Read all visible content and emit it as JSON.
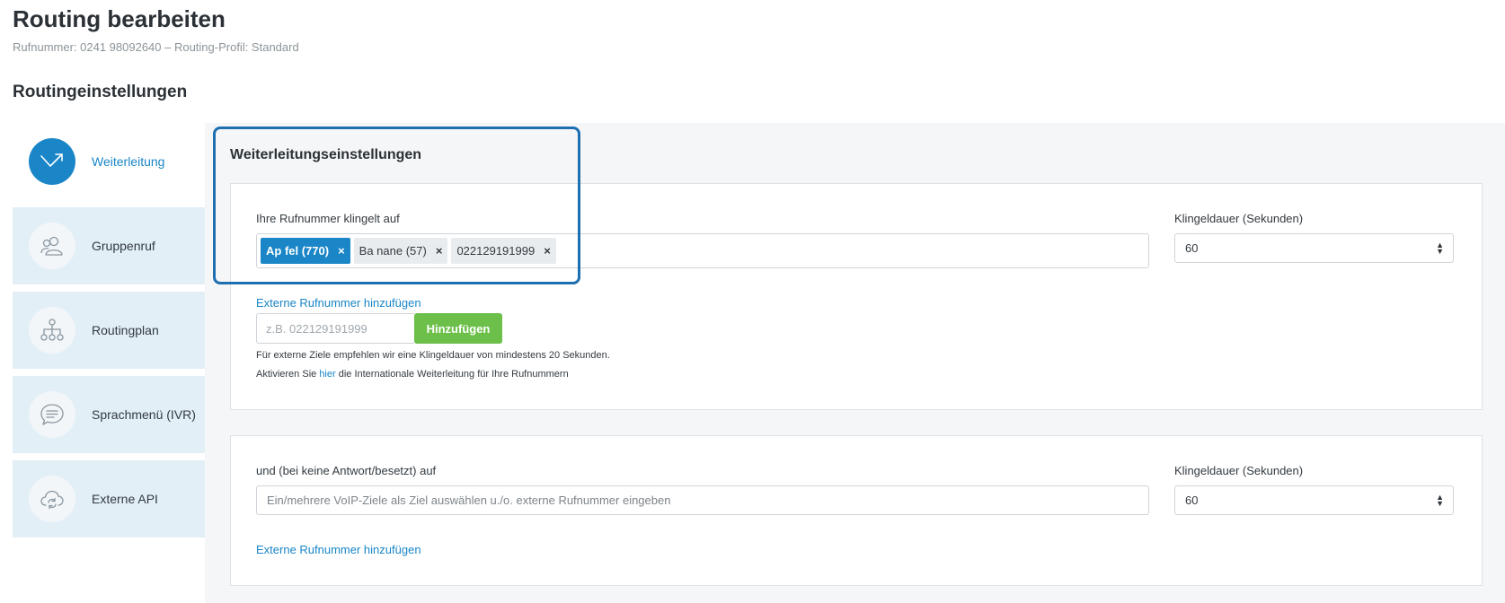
{
  "header": {
    "title": "Routing bearbeiten",
    "subtitle": "Rufnummer: 0241 98092640 – Routing-Profil: Standard",
    "section_title": "Routingeinstellungen"
  },
  "sidebar": {
    "items": [
      {
        "label": "Weiterleitung",
        "icon": "forward-arrow-icon",
        "active": true
      },
      {
        "label": "Gruppenruf",
        "icon": "group-icon",
        "active": false
      },
      {
        "label": "Routingplan",
        "icon": "hierarchy-icon",
        "active": false
      },
      {
        "label": "Sprachmenü (IVR)",
        "icon": "speech-bubble-icon",
        "active": false
      },
      {
        "label": "Externe API",
        "icon": "cloud-sync-icon",
        "active": false
      }
    ]
  },
  "forwarding": {
    "heading": "Weiterleitungseinstellungen",
    "primary": {
      "label": "Ihre Rufnummer klingelt auf",
      "tags": [
        {
          "text": "Ap fel (770)",
          "style": "primary"
        },
        {
          "text": "Ba nane (57)",
          "style": "default"
        },
        {
          "text": "022129191999",
          "style": "default"
        }
      ],
      "tag_remove": "×",
      "ring_label": "Klingeldauer (Sekunden)",
      "ring_value": "60",
      "add_external_link": "Externe Rufnummer hinzufügen",
      "external_placeholder": "z.B. 022129191999",
      "add_button": "Hinzufügen",
      "hint1": "Für externe Ziele empfehlen wir eine Klingeldauer von mindestens 20 Sekunden.",
      "hint2_prefix": "Aktivieren Sie ",
      "hint2_link": "hier",
      "hint2_suffix": " die Internationale Weiterleitung für Ihre Rufnummern"
    },
    "secondary": {
      "label": "und (bei keine Antwort/besetzt) auf",
      "placeholder": "Ein/mehrere VoIP-Ziele als Ziel auswählen u./o. externe Rufnummer eingeben",
      "ring_label": "Klingeldauer (Sekunden)",
      "ring_value": "60",
      "add_external_link": "Externe Rufnummer hinzufügen"
    }
  },
  "colors": {
    "accent": "#1a86c7",
    "highlight_border": "#1e6fb0",
    "add_button": "#6cc04a",
    "sidebar_bg": "#e3eff7",
    "content_bg": "#f5f6f8"
  }
}
